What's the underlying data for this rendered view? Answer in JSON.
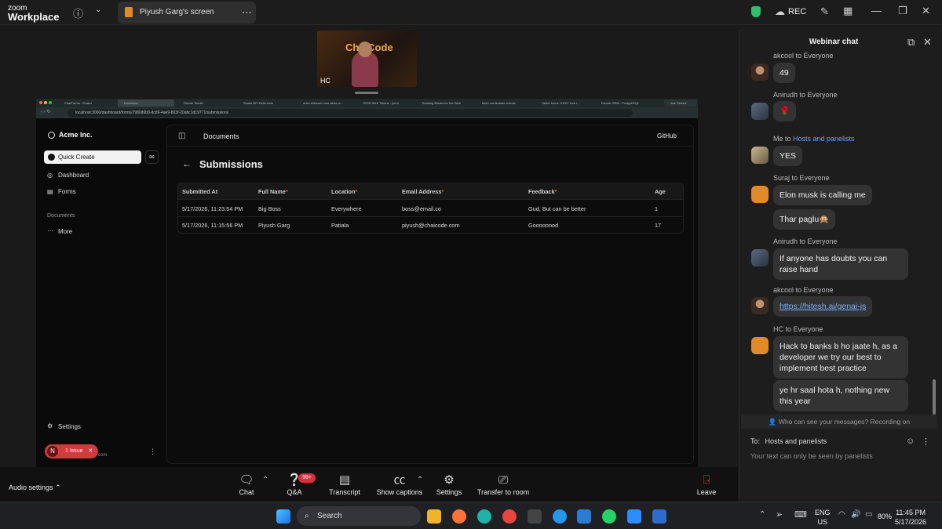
{
  "app": {
    "logo_line1": "zoom",
    "logo_line2": "Workplace",
    "share_title": "Piyush Garg's screen",
    "rec_label": "REC"
  },
  "video": {
    "brand": "ChaiCode",
    "initials": "HC"
  },
  "browser": {
    "tabs": [
      "ChatForms - Eraser",
      "Dreamzzz",
      "Drizzle Studio",
      "Scalar API Reference",
      "does wildcard cors allow cr...",
      "JSON Web Tokens - jwt.io",
      "Building Blocks for the Web",
      "fetch credentials include",
      "Tabler Icons: 6100+ free i...",
      "Drizzle ORM - PostgreSQL",
      "Ask Gemini"
    ],
    "url": "localhost:3000/dashboard/forms/7980d6b0-dcd9-4ae9-803f-20abc1d19771/submissions"
  },
  "sidebar": {
    "brand": "Acme Inc.",
    "quick_create": "Quick Create",
    "items": [
      "Dashboard",
      "Forms"
    ],
    "section": "Documents",
    "more": "More",
    "settings": "Settings",
    "issue_initial": "N",
    "issue_label": "1 Issue",
    "issue_suffix": "com"
  },
  "main": {
    "breadcrumb": "Documents",
    "github": "GitHub",
    "title": "Submissions",
    "headers": [
      "Submitted At",
      "Full Name",
      "Location",
      "Email Address",
      "Feedback",
      "Age"
    ],
    "required": [
      false,
      true,
      true,
      true,
      true,
      false
    ],
    "rows": [
      [
        "5/17/2026, 11:23:54 PM",
        "Big Boss",
        "Everywhere",
        "boss@email.co",
        "Gud, But can be better",
        "1"
      ],
      [
        "5/17/2026, 11:15:56 PM",
        "Piyush Garg",
        "Patiala",
        "piyush@chaicode.com",
        "Goooooood",
        "17"
      ]
    ]
  },
  "chat": {
    "title": "Webinar chat",
    "messages": [
      {
        "sender": "akcool to Everyone",
        "text": "49"
      },
      {
        "sender": "Anirudh to Everyone",
        "text": "🌹"
      },
      {
        "sender_a": "Me to ",
        "sender_b": "Hosts and panelists",
        "text": "YES"
      },
      {
        "sender": "Suraj to Everyone",
        "text": "Elon musk is calling me"
      },
      {
        "text": "Thar paglu🙊"
      },
      {
        "sender": "Anirudh to Everyone",
        "text": "If anyone has doubts you can raise hand"
      },
      {
        "sender": "akcool to Everyone",
        "text": "https://hitesh.ai/genai-js"
      },
      {
        "sender": "HC to Everyone",
        "text": "Hack to banks b ho jaate h, as a developer we try our best to implement best practice"
      },
      {
        "text": "ye hr saal hota h, nothing new this year"
      }
    ],
    "notice": "Who can see your messages? Recording on",
    "to_label": "To:",
    "to_value": "Hosts and panelists",
    "placeholder": "Your text can only be seen by panelists"
  },
  "toolbar": {
    "audio": "Audio settings",
    "buttons": [
      "Chat",
      "Q&A",
      "Transcript",
      "Show captions",
      "Settings",
      "Transfer to room",
      "Leave"
    ],
    "qa_badge": "99+"
  },
  "taskbar": {
    "search": "Search",
    "lang1": "ENG",
    "lang2": "US",
    "battery": "80%",
    "time": "11:45 PM",
    "date": "5/17/2026"
  }
}
